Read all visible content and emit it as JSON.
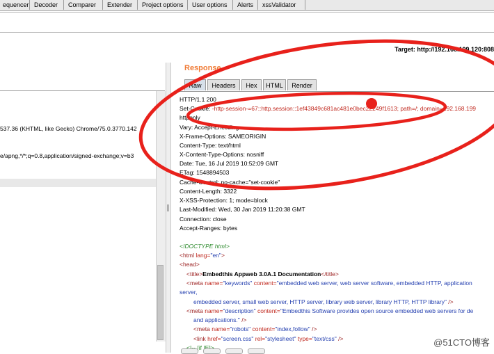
{
  "toolbar": {
    "tabs": [
      {
        "label": "equencer"
      },
      {
        "label": "Decoder"
      },
      {
        "label": "Comparer"
      },
      {
        "label": "Extender"
      },
      {
        "label": "Project options"
      },
      {
        "label": "User options"
      },
      {
        "label": "Alerts"
      },
      {
        "label": "xssValidator"
      }
    ]
  },
  "target": {
    "label": "Target: http://192.168.199.120:808"
  },
  "request_panel": {
    "lines": [
      "537.36 (KHTML, like Gecko) Chrome/75.0.3770.142",
      "e/apng,*/*;q=0.8,application/signed-exchange;v=b3"
    ]
  },
  "response_panel": {
    "title": "Response",
    "tabs": [
      {
        "label": "Raw",
        "active": true
      },
      {
        "label": "Headers",
        "active": false
      },
      {
        "label": "Hex",
        "active": false
      },
      {
        "label": "HTML",
        "active": false
      },
      {
        "label": "Render",
        "active": false
      }
    ],
    "headers": [
      {
        "text": "HTTP/1.1 200"
      },
      {
        "name": "Set-Cookie: ",
        "value": "-http-session-=67::http.session::1ef43849c681ac481e0bec22249f1613; path=/; domain=192.168.199"
      },
      {
        "text": "httponly"
      },
      {
        "text": "Vary: Accept-Encoding"
      },
      {
        "text": "X-Frame-Options: SAMEORIGIN"
      },
      {
        "text": "Content-Type: text/html"
      },
      {
        "text": "X-Content-Type-Options: nosniff"
      },
      {
        "text": "Date: Tue, 16 Jul 2019 10:52:09 GMT"
      },
      {
        "text": "ETag: 1548894503"
      },
      {
        "text": "Cache-Control: no-cache=\"set-cookie\""
      },
      {
        "text": "Content-Length: 3322"
      },
      {
        "text": "X-XSS-Protection: 1; mode=block"
      },
      {
        "text": "Last-Modified: Wed, 30 Jan 2019 11:20:38 GMT"
      },
      {
        "text": "Connection: close"
      },
      {
        "text": "Accept-Ranges: bytes"
      }
    ],
    "html": {
      "doctype": "<!DOCTYPE html>",
      "html_open": "<html",
      "html_attr": " lang=",
      "html_attr_val": "\"en\"",
      "head": "<head>",
      "title_open": "<title>",
      "title_text": "Embedthis Appweb 3.0A.1 Documentation",
      "title_close": "</title>",
      "meta1_open": "<meta",
      "meta1_name": " name=",
      "meta1_name_val": "\"keywords\"",
      "meta1_content": " content=",
      "meta1_content_val": "\"embedded web server, web server software, embedded HTTP, application",
      "meta1_cont1": "server,",
      "meta1_cont2": "embedded server, small web server, HTTP server, library web server, library HTTP, HTTP library\"",
      "meta1_close": " />",
      "meta2_open": "<meta",
      "meta2_name": " name=",
      "meta2_name_val": "\"description\"",
      "meta2_content": " content=",
      "meta2_content_val": "\"Embedthis Software provides open source embedded web servers for de",
      "meta2_cont": "and applications.\"",
      "meta2_close": " />",
      "meta3_open": "<meta",
      "meta3_name": " name=",
      "meta3_name_val": "\"robots\"",
      "meta3_content": " content=",
      "meta3_content_val": "\"index,follow\"",
      "meta3_close": " />",
      "link_open": "<link",
      "link_href": " href=",
      "link_href_val": "\"screen.css\"",
      "link_rel": " rel=",
      "link_rel_val": "\"stylesheet\"",
      "link_type": " type=",
      "link_type_val": "\"text/css\"",
      "link_close": " />",
      "partial": "<!-- [if IE]>"
    }
  },
  "watermark": "@51CTO博客",
  "annotation_color": "#e8211b"
}
